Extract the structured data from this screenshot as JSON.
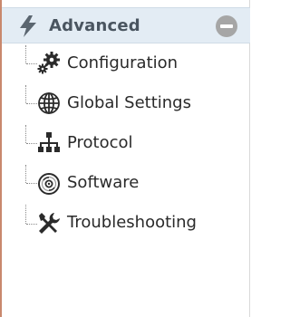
{
  "section": {
    "title": "Advanced",
    "icon": "lightning-bolt-icon",
    "collapse_icon": "minus-circle-icon"
  },
  "items": [
    {
      "label": "Configuration",
      "icon": "gears-icon"
    },
    {
      "label": "Global Settings",
      "icon": "globe-icon"
    },
    {
      "label": "Protocol",
      "icon": "network-hierarchy-icon"
    },
    {
      "label": "Software",
      "icon": "disc-icon"
    },
    {
      "label": "Troubleshooting",
      "icon": "tools-icon"
    }
  ],
  "colors": {
    "header_background": "#e3ecf4",
    "header_text": "#4a5560",
    "item_text": "#2a2a2a",
    "icon_dark": "#2b2b2b",
    "collapse_button": "#a6a6a6",
    "left_accent": "#c9886d"
  }
}
